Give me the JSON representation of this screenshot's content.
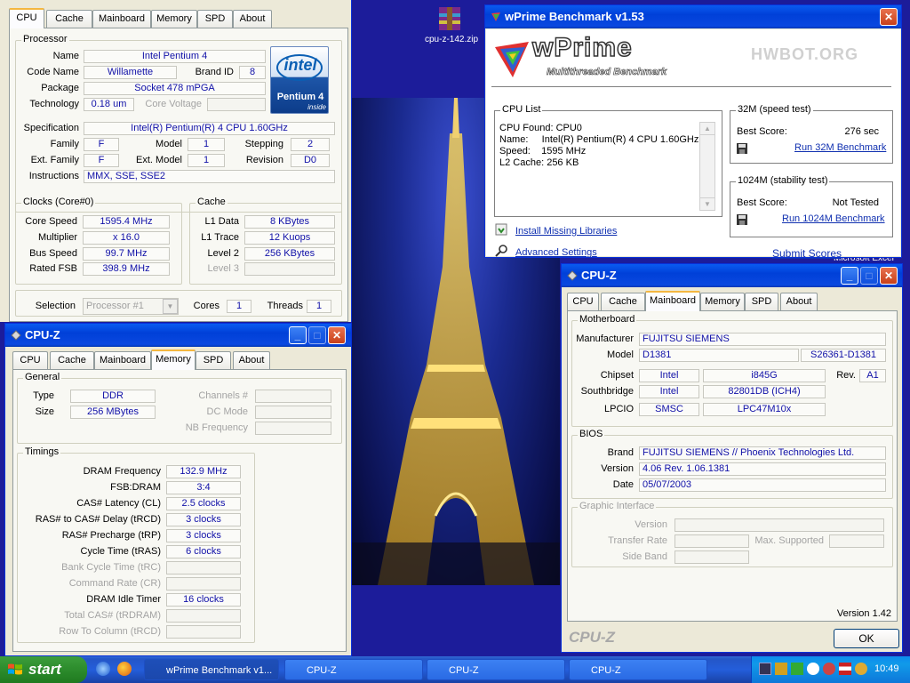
{
  "desktop": {
    "icon_label": "cpu-z-142.zip",
    "partial_label": "Microsoft Excel"
  },
  "cpuz_main": {
    "tabs": [
      "CPU",
      "Cache",
      "Mainboard",
      "Memory",
      "SPD",
      "About"
    ],
    "processor": {
      "group": "Processor",
      "name_label": "Name",
      "name": "Intel Pentium 4",
      "codename_label": "Code Name",
      "codename": "Willamette",
      "brandid_label": "Brand ID",
      "brandid": "8",
      "package_label": "Package",
      "package": "Socket 478 mPGA",
      "technology_label": "Technology",
      "technology": "0.18 um",
      "corevoltage_label": "Core Voltage",
      "spec_label": "Specification",
      "spec": "Intel(R) Pentium(R) 4 CPU 1.60GHz",
      "family_label": "Family",
      "family": "F",
      "model_label": "Model",
      "model": "1",
      "stepping_label": "Stepping",
      "stepping": "2",
      "extfamily_label": "Ext. Family",
      "extfamily": "F",
      "extmodel_label": "Ext. Model",
      "extmodel": "1",
      "revision_label": "Revision",
      "revision": "D0",
      "instructions_label": "Instructions",
      "instructions": "MMX, SSE, SSE2",
      "logo_brand": "intel",
      "logo_product": "Pentium 4",
      "logo_inside": "inside"
    },
    "clocks": {
      "group": "Clocks (Core#0)",
      "corespeed_label": "Core Speed",
      "corespeed": "1595.4 MHz",
      "multiplier_label": "Multiplier",
      "multiplier": "x 16.0",
      "busspeed_label": "Bus Speed",
      "busspeed": "99.7 MHz",
      "ratedfsb_label": "Rated FSB",
      "ratedfsb": "398.9 MHz"
    },
    "cache": {
      "group": "Cache",
      "l1data_label": "L1 Data",
      "l1data": "8 KBytes",
      "l1trace_label": "L1 Trace",
      "l1trace": "12 Kuops",
      "level2_label": "Level 2",
      "level2": "256 KBytes",
      "level3_label": "Level 3"
    },
    "selection_label": "Selection",
    "selection": "Processor #1",
    "cores_label": "Cores",
    "cores": "1",
    "threads_label": "Threads",
    "threads": "1"
  },
  "cpuz_memory": {
    "title": "CPU-Z",
    "tabs": [
      "CPU",
      "Cache",
      "Mainboard",
      "Memory",
      "SPD",
      "About"
    ],
    "general": {
      "group": "General",
      "type_label": "Type",
      "type": "DDR",
      "size_label": "Size",
      "size": "256 MBytes",
      "channels_label": "Channels #",
      "dcmode_label": "DC Mode",
      "nbfreq_label": "NB Frequency"
    },
    "timings": {
      "group": "Timings",
      "rows": [
        {
          "label": "DRAM Frequency",
          "value": "132.9 MHz",
          "enabled": true
        },
        {
          "label": "FSB:DRAM",
          "value": "3:4",
          "enabled": true
        },
        {
          "label": "CAS# Latency (CL)",
          "value": "2.5 clocks",
          "enabled": true
        },
        {
          "label": "RAS# to CAS# Delay (tRCD)",
          "value": "3 clocks",
          "enabled": true
        },
        {
          "label": "RAS# Precharge (tRP)",
          "value": "3 clocks",
          "enabled": true
        },
        {
          "label": "Cycle Time (tRAS)",
          "value": "6 clocks",
          "enabled": true
        },
        {
          "label": "Bank Cycle Time (tRC)",
          "value": "",
          "enabled": false
        },
        {
          "label": "Command Rate (CR)",
          "value": "",
          "enabled": false
        },
        {
          "label": "DRAM Idle Timer",
          "value": "16 clocks",
          "enabled": true
        },
        {
          "label": "Total CAS# (tRDRAM)",
          "value": "",
          "enabled": false
        },
        {
          "label": "Row To Column (tRCD)",
          "value": "",
          "enabled": false
        }
      ]
    }
  },
  "wprime": {
    "title": "wPrime Benchmark v1.53",
    "logo": "wPrime",
    "logo_sub": "Multithreaded Benchmark",
    "hwbot": "HWBOT.ORG",
    "cpulist": {
      "group": "CPU List",
      "lines": [
        "CPU Found: CPU0",
        "Name:     Intel(R) Pentium(R) 4 CPU 1.60GHz",
        "Speed:    1595 MHz",
        "L2 Cache: 256 KB"
      ]
    },
    "test32": {
      "group": "32M (speed test)",
      "best_label": "Best Score:",
      "best": "276 sec",
      "run": "Run 32M Benchmark"
    },
    "test1024": {
      "group": "1024M (stability test)",
      "best_label": "Best Score:",
      "best": "Not Tested",
      "run": "Run 1024M Benchmark"
    },
    "install": "Install Missing Libraries",
    "advanced": "Advanced Settings",
    "submit": "Submit Scores"
  },
  "cpuz_mainboard": {
    "title": "CPU-Z",
    "tabs": [
      "CPU",
      "Cache",
      "Mainboard",
      "Memory",
      "SPD",
      "About"
    ],
    "motherboard": {
      "group": "Motherboard",
      "manufacturer_label": "Manufacturer",
      "manufacturer": "FUJITSU SIEMENS",
      "model_label": "Model",
      "model": "D1381",
      "model2": "S26361-D1381",
      "chipset_label": "Chipset",
      "chipset_vendor": "Intel",
      "chipset": "i845G",
      "rev_label": "Rev.",
      "rev": "A1",
      "southbridge_label": "Southbridge",
      "southbridge_vendor": "Intel",
      "southbridge": "82801DB (ICH4)",
      "lpcio_label": "LPCIO",
      "lpcio_vendor": "SMSC",
      "lpcio": "LPC47M10x"
    },
    "bios": {
      "group": "BIOS",
      "brand_label": "Brand",
      "brand": "FUJITSU SIEMENS // Phoenix Technologies Ltd.",
      "version_label": "Version",
      "version": "4.06  Rev. 1.06.1381",
      "date_label": "Date",
      "date": "05/07/2003"
    },
    "graphic": {
      "group": "Graphic Interface",
      "version_label": "Version",
      "transfer_label": "Transfer Rate",
      "maxsupported_label": "Max. Supported",
      "sideband_label": "Side Band"
    },
    "version": "Version 1.42",
    "brand": "CPU-Z",
    "ok": "OK"
  },
  "taskbar": {
    "start": "start",
    "items": [
      "wPrime Benchmark v1...",
      "CPU-Z",
      "CPU-Z",
      "CPU-Z"
    ],
    "clock": "10:49"
  }
}
